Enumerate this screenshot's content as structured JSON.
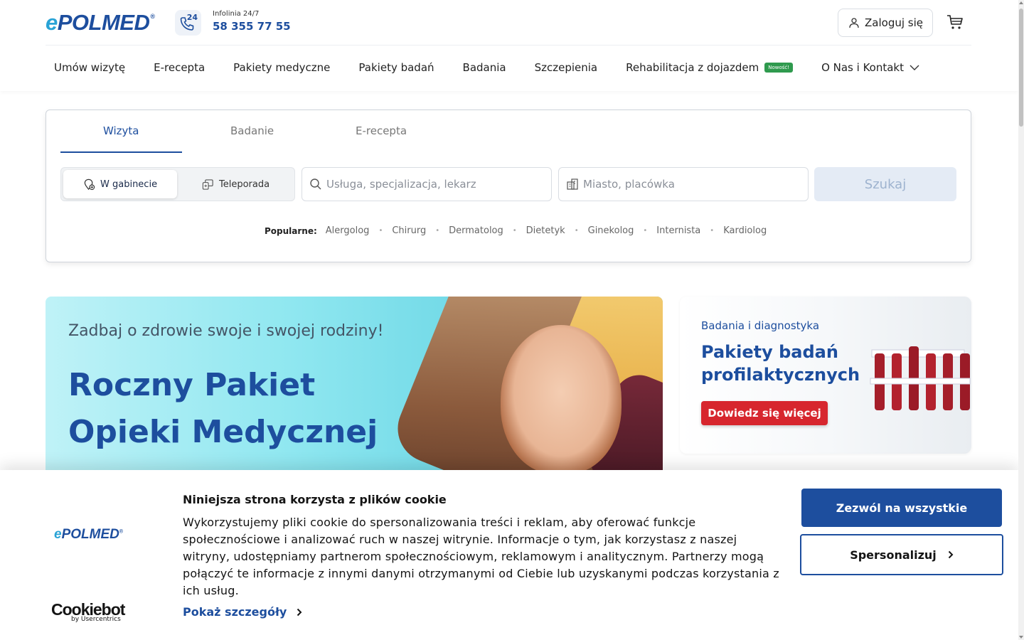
{
  "brand": {
    "logo_e": "e",
    "logo_rest": "POLMED",
    "logo_reg": "®"
  },
  "header": {
    "hotline_badge": "24",
    "hotline_label": "Infolinia 24/7",
    "hotline_number": "58 355 77 55",
    "login_label": "Zaloguj się"
  },
  "nav": {
    "items": [
      {
        "label": "Umów wizytę"
      },
      {
        "label": "E-recepta"
      },
      {
        "label": "Pakiety medyczne"
      },
      {
        "label": "Pakiety badań"
      },
      {
        "label": "Badania"
      },
      {
        "label": "Szczepienia"
      },
      {
        "label": "Rehabilitacja z dojazdem",
        "badge": "Nowość!"
      },
      {
        "label": "O Nas i Kontakt"
      }
    ]
  },
  "search": {
    "tabs": [
      {
        "label": "Wizyta",
        "active": true
      },
      {
        "label": "Badanie",
        "active": false
      },
      {
        "label": "E-recepta",
        "active": false
      }
    ],
    "mode_in_office": "W gabinecie",
    "mode_tele": "Teleporada",
    "service_placeholder": "Usługa, specjalizacja, lekarz",
    "location_placeholder": "Miasto, placówka",
    "button_label": "Szukaj",
    "popular_label": "Popularne:",
    "popular": [
      "Alergolog",
      "Chirurg",
      "Dermatolog",
      "Dietetyk",
      "Ginekolog",
      "Internista",
      "Kardiolog"
    ]
  },
  "hero": {
    "subtitle": "Zadbaj o zdrowie swoje i swojej rodziny!",
    "title_line1": "Roczny Pakiet",
    "title_line2": "Opieki Medycznej"
  },
  "promo": {
    "subtitle": "Badania i diagnostyka",
    "title_line1": "Pakiety badań",
    "title_line2": "profilaktycznych",
    "button_label": "Dowiedz się więcej"
  },
  "cookie": {
    "logo_e": "e",
    "logo_rest": "POLMED",
    "logo_reg": "®",
    "provider": "Cookiebot",
    "provider_by": "by Usercentrics",
    "title": "Niniejsza strona korzysta z plików cookie",
    "text": "Wykorzystujemy pliki cookie do spersonalizowania treści i reklam, aby oferować funkcje społecznościowe i analizować ruch w naszej witrynie. Informacje o tym, jak korzystasz z naszej witryny, udostępniamy partnerom społecznościowym, reklamowym i analitycznym. Partnerzy mogą połączyć te informacje z innymi danymi otrzymanymi od Ciebie lub uzyskanymi podczas korzystania z ich usług.",
    "details_label": "Pokaż szczegóły",
    "allow_all_label": "Zezwól na wszystkie",
    "customize_label": "Spersonalizuj"
  },
  "colors": {
    "brand_blue": "#1d4e9e",
    "accent_cyan": "#29a3d6",
    "cta_red": "#d7262e",
    "badge_green": "#2f9a4e"
  }
}
